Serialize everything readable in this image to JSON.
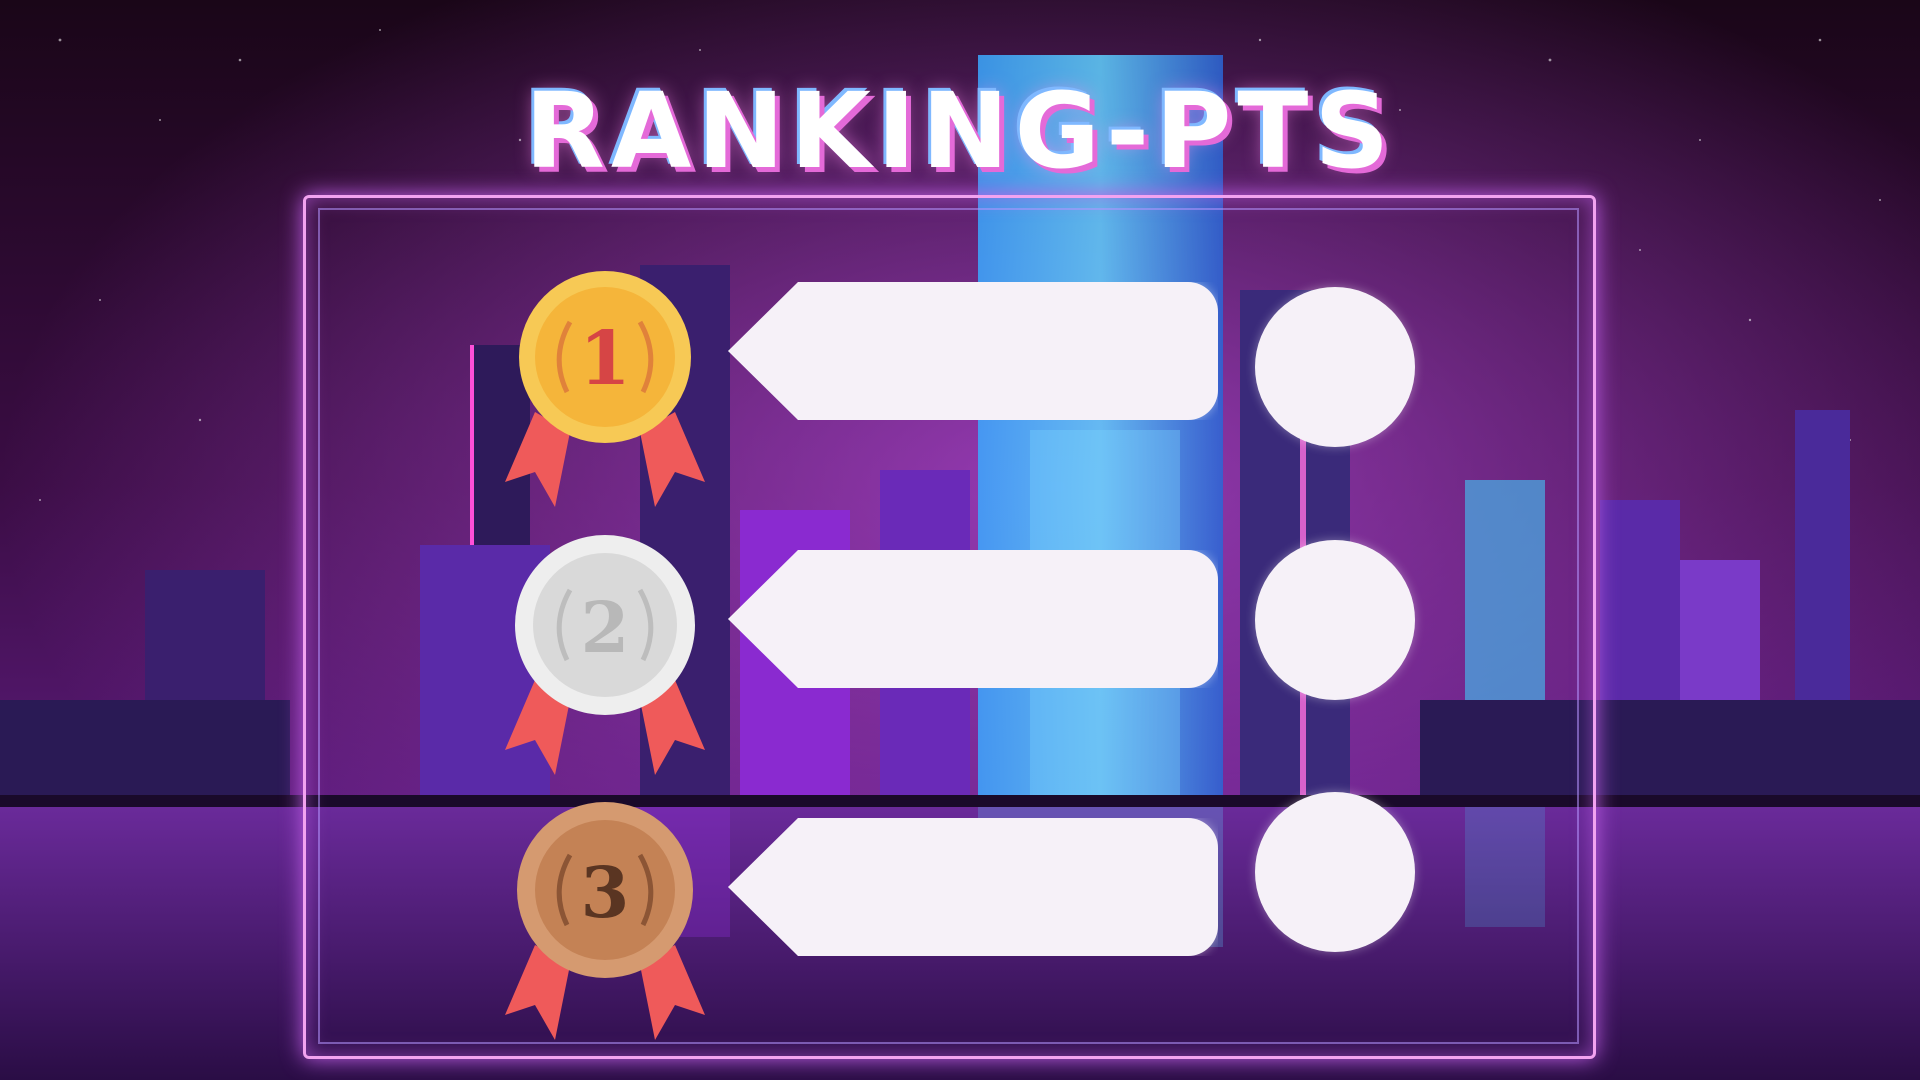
{
  "title": "RANKING-PTS",
  "colors": {
    "title_fill": "#ffffff",
    "title_shadow": "#e46ad8",
    "frame_border": "#f2a3f0",
    "gold": "#f5b53a",
    "silver": "#d9d9d9",
    "bronze": "#c48255",
    "ribbon": "#ef5a5a",
    "placeholder": "#f6f1f8"
  },
  "ranks": [
    {
      "place": "1",
      "medal": "gold-medal-icon",
      "name": "",
      "points": ""
    },
    {
      "place": "2",
      "medal": "silver-medal-icon",
      "name": "",
      "points": ""
    },
    {
      "place": "3",
      "medal": "bronze-medal-icon",
      "name": "",
      "points": ""
    }
  ]
}
